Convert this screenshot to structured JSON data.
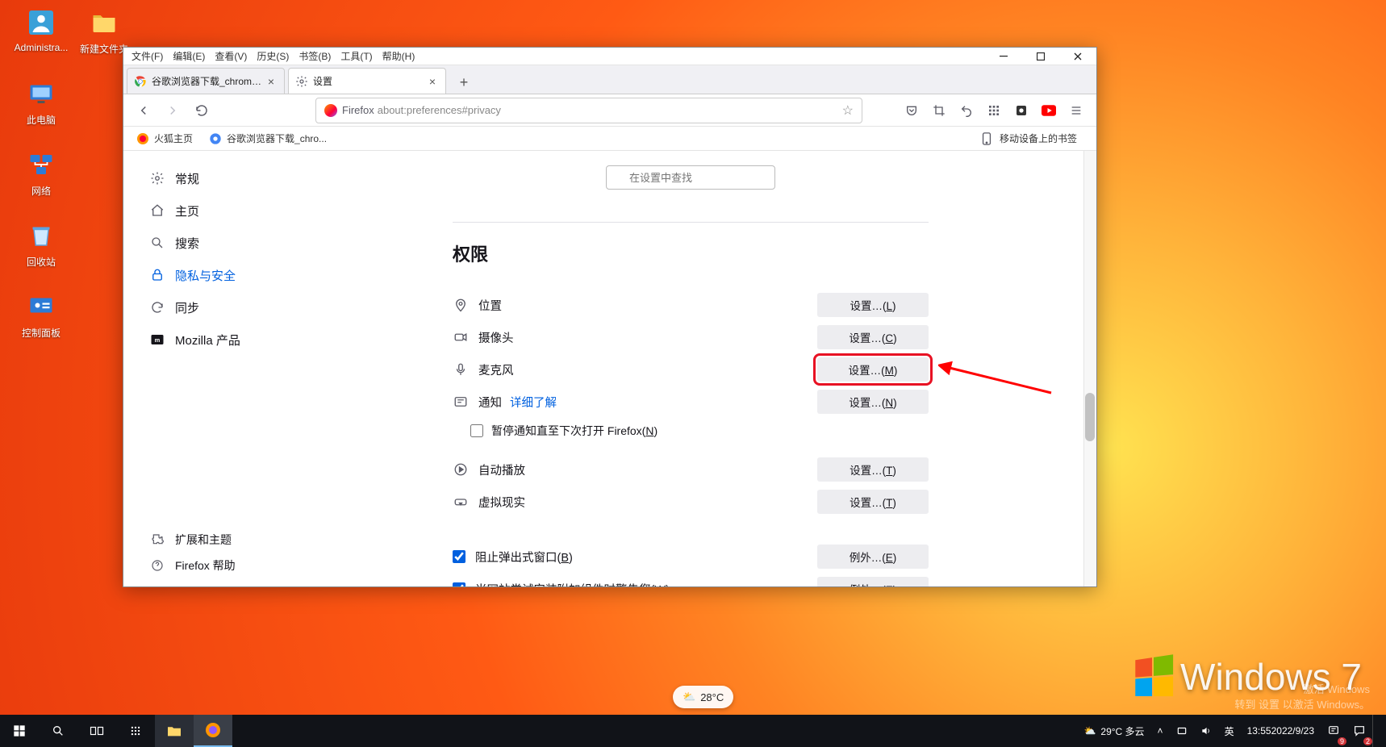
{
  "desktop": {
    "icons": [
      {
        "label": "Administra...",
        "name": "administrator-icon"
      },
      {
        "label": "新建文件夹",
        "name": "new-folder-icon"
      },
      {
        "label": "此电脑",
        "name": "this-pc-icon"
      },
      {
        "label": "网络",
        "name": "network-icon"
      },
      {
        "label": "回收站",
        "name": "recycle-bin-icon"
      },
      {
        "label": "控制面板",
        "name": "control-panel-icon"
      }
    ]
  },
  "menubar": [
    "文件(F)",
    "编辑(E)",
    "查看(V)",
    "历史(S)",
    "书签(B)",
    "工具(T)",
    "帮助(H)"
  ],
  "tabs": [
    {
      "title": "谷歌浏览器下载_chrome浏览器",
      "active": false
    },
    {
      "title": "设置",
      "active": true
    }
  ],
  "urlbar": {
    "host": "Firefox",
    "path": "about:preferences#privacy"
  },
  "bookmarks": {
    "left": [
      "火狐主页",
      "谷歌浏览器下载_chro..."
    ],
    "right": "移动设备上的书签"
  },
  "sidebar": {
    "items": [
      {
        "label": "常规",
        "icon": "gear"
      },
      {
        "label": "主页",
        "icon": "home"
      },
      {
        "label": "搜索",
        "icon": "search"
      },
      {
        "label": "隐私与安全",
        "icon": "lock",
        "active": true
      },
      {
        "label": "同步",
        "icon": "sync"
      },
      {
        "label": "Mozilla 产品",
        "icon": "mozilla"
      }
    ],
    "footer": [
      {
        "label": "扩展和主题",
        "icon": "puzzle"
      },
      {
        "label": "Firefox 帮助",
        "icon": "help"
      }
    ]
  },
  "settings_search_placeholder": "在设置中查找",
  "section_title": "权限",
  "permissions": {
    "location": {
      "label": "位置",
      "button": "设置…(L)"
    },
    "camera": {
      "label": "摄像头",
      "button": "设置…(C)"
    },
    "microphone": {
      "label": "麦克风",
      "button": "设置…(M)"
    },
    "notify": {
      "label": "通知",
      "link": "详细了解",
      "button": "设置…(N)"
    },
    "autoplay": {
      "label": "自动播放",
      "button": "设置…(T)"
    },
    "vr": {
      "label": "虚拟现实",
      "button": "设置…(T)"
    }
  },
  "pause_notify_label": "暂停通知直至下次打开 Firefox(N)",
  "block_popup_label": "阻止弹出式窗口(B)",
  "block_popup_button": "例外…(E)",
  "warn_addon_label": "当网站尝试安装附加组件时警告您(W)",
  "warn_addon_button": "例外…(E)",
  "watermark": {
    "text": "Windows 7",
    "activate_line1": "激活 Windows",
    "activate_line2": "转到 设置 以激活 Windows。"
  },
  "taskbar": {
    "weather_pill": "28°C",
    "tray_weather": "29°C 多云",
    "ime": "英",
    "time": "13:55",
    "date": "2022/9/23",
    "notif_badge1": "9",
    "notif_badge2": "2"
  }
}
